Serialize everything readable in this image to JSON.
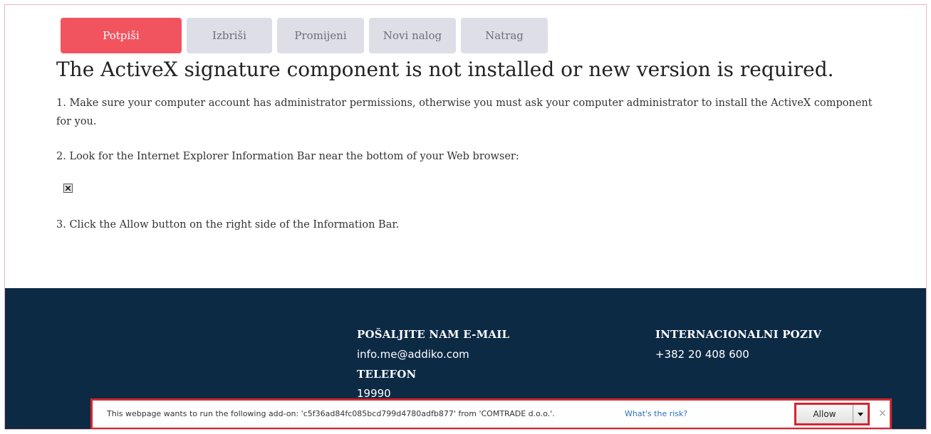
{
  "toolbar": {
    "sign_label": "Potpiši",
    "delete_label": "Izbriši",
    "change_label": "Promijeni",
    "new_order_label": "Novi nalog",
    "back_label": "Natrag"
  },
  "main": {
    "title": "The ActiveX signature component is not installed or new version is required.",
    "step1": "1. Make sure your computer account has administrator permissions, otherwise you must ask your computer administrator to install the ActiveX component for you.",
    "step2": "2. Look for the Internet Explorer Information Bar near the bottom of your Web browser:",
    "step3": "3. Click the Allow button on the right side of the Information Bar."
  },
  "footer": {
    "email_heading": "POŠALJITE NAM E-MAIL",
    "email_value": "info.me@addiko.com",
    "phone_heading": "TELEFON",
    "phone_value": "19990",
    "intl_heading": "INTERNACIONALNI POZIV",
    "intl_value": "+382 20 408 600"
  },
  "infobar": {
    "message": "This webpage wants to run the following add-on: 'c5f36ad84fc085bcd799d4780adfb877' from 'COMTRADE d.o.o.'.",
    "risk_link": "What's the risk?",
    "allow_label": "Allow",
    "close_glyph": "×"
  },
  "colors": {
    "primary_button": "#f2545f",
    "footer_bg": "#0d2a45",
    "highlight_border": "#d3262f"
  }
}
